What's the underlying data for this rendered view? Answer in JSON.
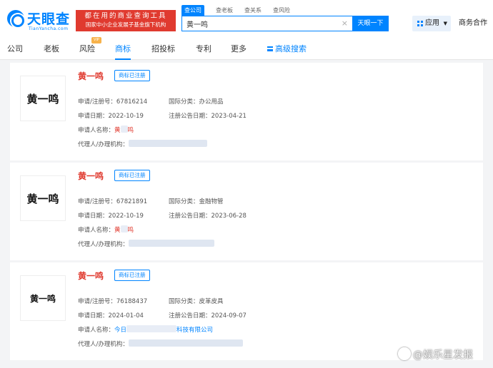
{
  "header": {
    "logo_name": "天眼查",
    "logo_domain": "TianYancha.com",
    "banner_line1": "都在用的商业查询工具",
    "banner_line2": "国家中小企业发展子基金旗下机构",
    "search_tabs": [
      "查公司",
      "查老板",
      "查关系",
      "查风险"
    ],
    "search_value": "黄一鸣",
    "clear_glyph": "×",
    "search_button": "天眼一下",
    "apps_label": "应用",
    "apps_caret": "▼",
    "business_link": "商务合作"
  },
  "nav": {
    "items": [
      "公司",
      "老板",
      "风险",
      "商标",
      "招投标",
      "专利",
      "更多"
    ],
    "vip_badge": "VIP",
    "advanced_search": "高级搜索",
    "active": "商标"
  },
  "trademarks": [
    {
      "image_text": "黄一鸣",
      "name": "黄一鸣",
      "status": "商标已注册",
      "reg_label": "申请/注册号：",
      "reg_no": "67816214",
      "class_label": "国际分类：",
      "class": "办公用品",
      "apply_label": "申请日期：",
      "apply_date": "2022-10-19",
      "pub_label": "注册公告日期：",
      "pub_date": "2023-04-21",
      "applicant_label": "申请人名称：",
      "applicant_a": "黄",
      "applicant_b": "鸣",
      "agent_label": "代理人/办理机构："
    },
    {
      "image_text": "黄一鸣",
      "name": "黄一鸣",
      "status": "商标已注册",
      "reg_label": "申请/注册号：",
      "reg_no": "67821891",
      "class_label": "国际分类：",
      "class": "金融物管",
      "apply_label": "申请日期：",
      "apply_date": "2022-10-19",
      "pub_label": "注册公告日期：",
      "pub_date": "2023-06-28",
      "applicant_label": "申请人名称：",
      "applicant_a": "黄",
      "applicant_b": "鸣",
      "agent_label": "代理人/办理机构："
    },
    {
      "image_text": "黄一鸣",
      "name": "黄一鸣",
      "status": "商标已注册",
      "reg_label": "申请/注册号：",
      "reg_no": "76188437",
      "class_label": "国际分类：",
      "class": "皮革皮具",
      "apply_label": "申请日期：",
      "apply_date": "2024-01-04",
      "pub_label": "注册公告日期：",
      "pub_date": "2024-09-07",
      "applicant_label": "申请人名称：",
      "applicant_a": "今日",
      "applicant_b": "科技有限公司",
      "agent_label": "代理人/办理机构："
    }
  ],
  "watermark": "@娱乐星发报",
  "colors": {
    "brand_blue": "#0084ff",
    "accent_red": "#e03a2f",
    "page_bg": "#f3f4f6",
    "vip_orange": "#f7b24a"
  },
  "icons": [
    "apps-grid-icon",
    "advanced-search-icon",
    "clear-icon",
    "weibo-icon"
  ]
}
